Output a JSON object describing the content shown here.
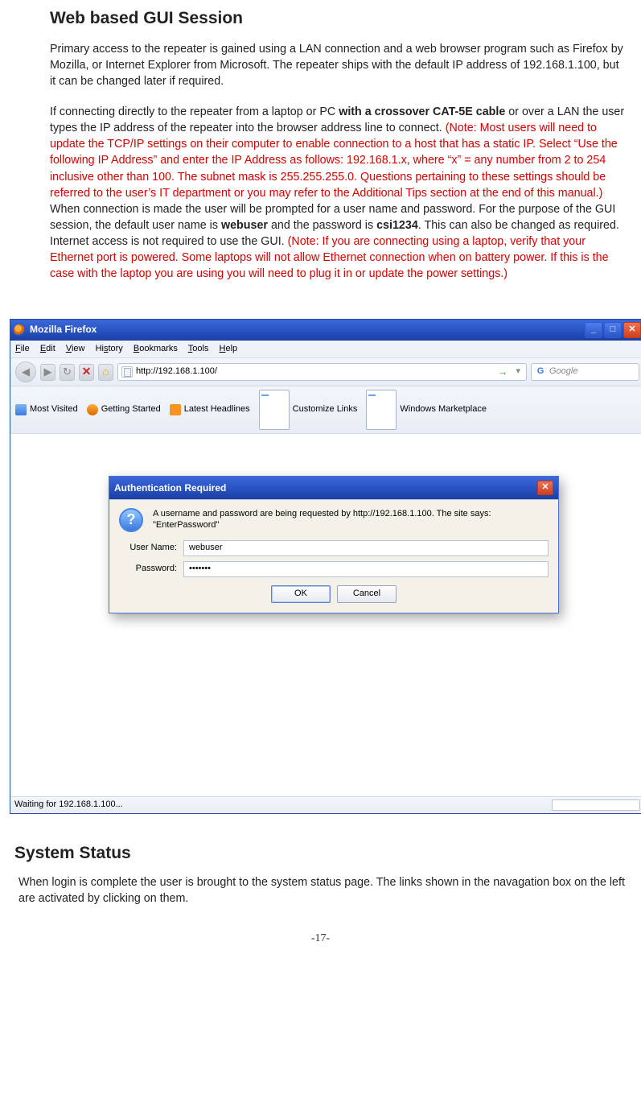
{
  "heading1": "Web based GUI Session",
  "para1": "Primary access to the repeater is  gained using a LAN connection and a web browser program such as Firefox by Mozilla, or Internet Explorer from Microsoft.  The repeater ships with the default IP address of 192.168.1.100, but it can be changed later if required.",
  "para2_a": "If connecting directly to the repeater from a laptop or PC ",
  "para2_b_bold": "with a crossover CAT-5E cable",
  "para2_c": " or over a LAN the user types the IP address of the repeater into the browser address line to connect. ",
  "para2_note1": "(Note: Most users will need to update the TCP/IP settings on their computer to enable connection to a host that has a static IP.  Select “Use the following IP Address” and enter the IP Address as follows: 192.168.1.x, where “x” = any number from 2 to 254 inclusive other than 100. The subnet mask is 255.255.255.0.  Questions pertaining to these settings should be referred to the user’s IT department or you may refer to the Additional Tips section at the end of this manual.)",
  "para2_d": "  When connection is made the user will be prompted for a user name and password. For the purpose of the GUI session, the default user name is ",
  "para2_e_bold": "webuser",
  "para2_f": " and the password is ",
  "para2_g_bold": "csi1234",
  "para2_h": ".  This can also be changed as required. Internet access is not required to use the GUI.  ",
  "para2_note2": "(Note: If you are connecting using a laptop, verify that your Ethernet port is powered.  Some laptops will not allow Ethernet connection when on battery power. If this is the case with the laptop you are using you will need to plug it in or update the power settings.)",
  "firefox": {
    "title": "Mozilla Firefox",
    "menu": {
      "file": "File",
      "edit": "Edit",
      "view": "View",
      "history": "History",
      "bookmarks": "Bookmarks",
      "tools": "Tools",
      "help": "Help"
    },
    "nav": {
      "reload": "↻",
      "stop": "✕",
      "home": "⌂",
      "url": "http://192.168.1.100/",
      "go": "→",
      "dd": "▾",
      "search_placeholder": "Google"
    },
    "bm": {
      "mostvisited": "Most Visited",
      "getting": "Getting Started",
      "latest": "Latest Headlines",
      "customize": "Customize Links",
      "marketplace": "Windows Marketplace"
    },
    "dialog": {
      "title": "Authentication Required",
      "close_glyph": "✕",
      "q_glyph": "?",
      "message": "A username and password are being requested by http://192.168.1.100. The site says: \"EnterPassword\"",
      "user_label": "User Name:",
      "user_value": "webuser",
      "pass_label": "Password:",
      "pass_value": "•••••••",
      "ok": "OK",
      "cancel": "Cancel"
    },
    "status": "Waiting for 192.168.1.100...",
    "winbtn": {
      "min": "_",
      "max": "□",
      "close": "✕"
    }
  },
  "heading2": "System Status",
  "para3": "When login is complete the user is brought to the system status page. The links shown in the navagation box on the left are activated by clicking on them.",
  "page_number": "-17-"
}
